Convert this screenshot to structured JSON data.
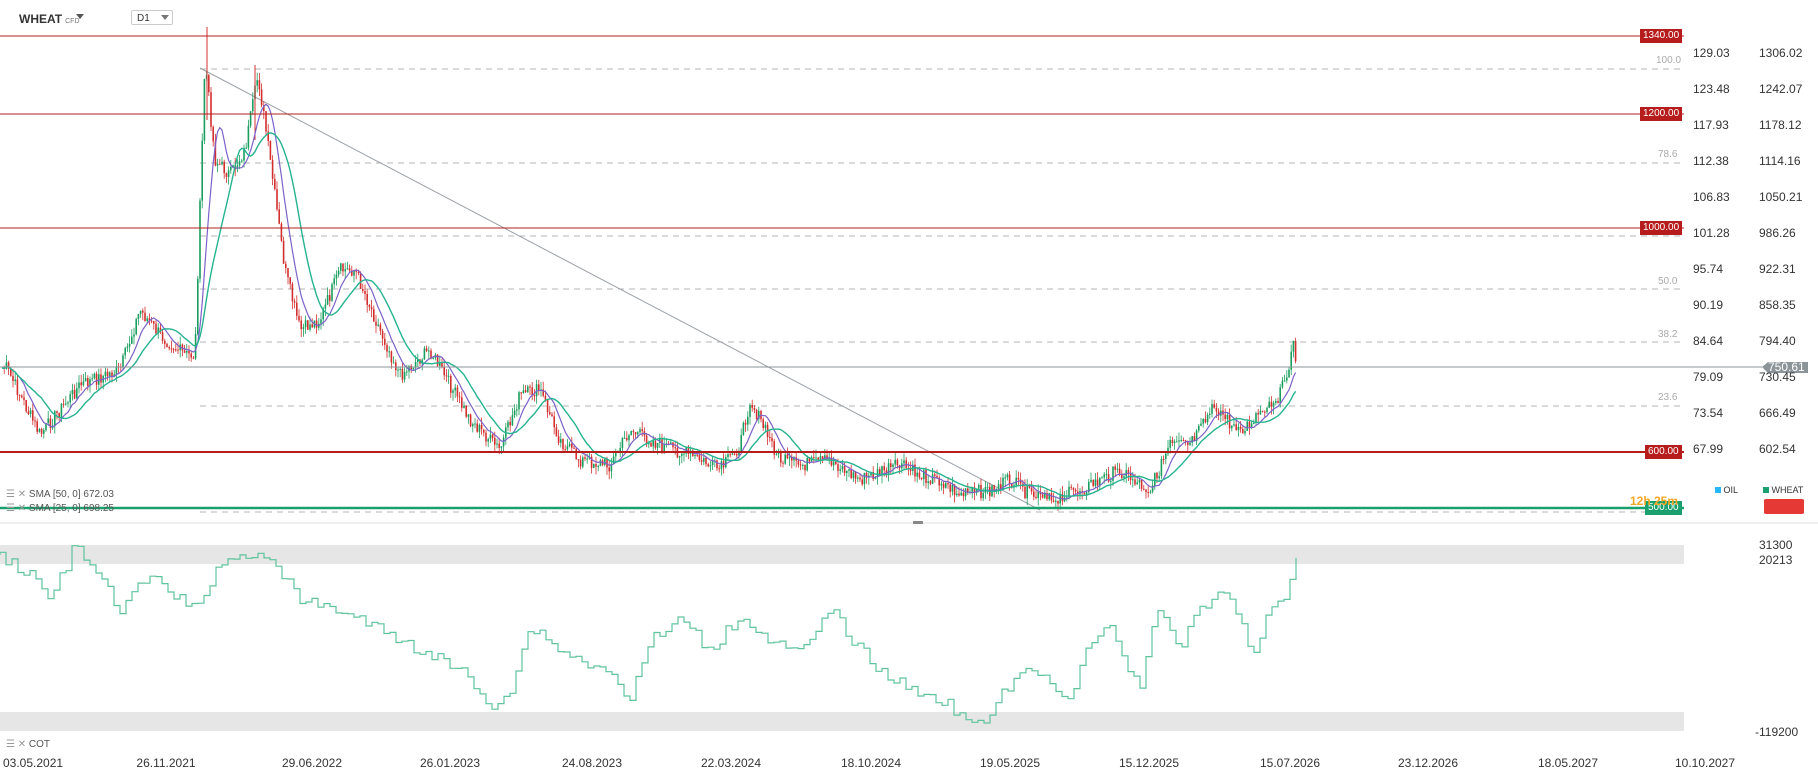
{
  "toolbar": {
    "symbol": "WHEAT",
    "symbol_tag": "CFD",
    "timeframe": "D1"
  },
  "price_axis_left": [
    "129.03",
    "123.48",
    "117.93",
    "112.38",
    "106.83",
    "101.28",
    "95.74",
    "90.19",
    "84.64",
    "79.09",
    "73.54",
    "67.99"
  ],
  "price_axis_right": [
    "1306.02",
    "1242.07",
    "1178.12",
    "1114.16",
    "1050.21",
    "986.26",
    "922.31",
    "858.35",
    "794.40",
    "730.45",
    "666.49",
    "602.54"
  ],
  "current_price": "750.61",
  "levels": [
    "1340.00",
    "1200.00",
    "1000.00",
    "600.00",
    "500.00"
  ],
  "fib_levels": [
    "100.0",
    "78.6",
    "50.0",
    "38.2",
    "23.6"
  ],
  "indicators": {
    "sma50": "SMA [50, 0] 672.03",
    "sma25": "SMA [25, 0] 698.25",
    "cot": "COT"
  },
  "countdown": "12h 25m",
  "legend": {
    "oil": "OIL",
    "wheat": "WHEAT"
  },
  "cot_axis": [
    "31300",
    "20213",
    "-119200"
  ],
  "x_dates": [
    "03.05.2021",
    "26.11.2021",
    "29.06.2022",
    "26.01.2023",
    "24.08.2023",
    "22.03.2024",
    "18.10.2024",
    "19.05.2025",
    "15.12.2025",
    "15.07.2026",
    "23.12.2026",
    "18.05.2027",
    "10.10.2027"
  ],
  "colors": {
    "level_line": "#b71c1c",
    "support_line": "#1aa06f",
    "up_candle": "#1a9e5f",
    "down_candle": "#d32f2f",
    "sma_fast": "#7b61c9",
    "sma_slow": "#26b38f",
    "cot_line": "#5fc39c"
  }
}
